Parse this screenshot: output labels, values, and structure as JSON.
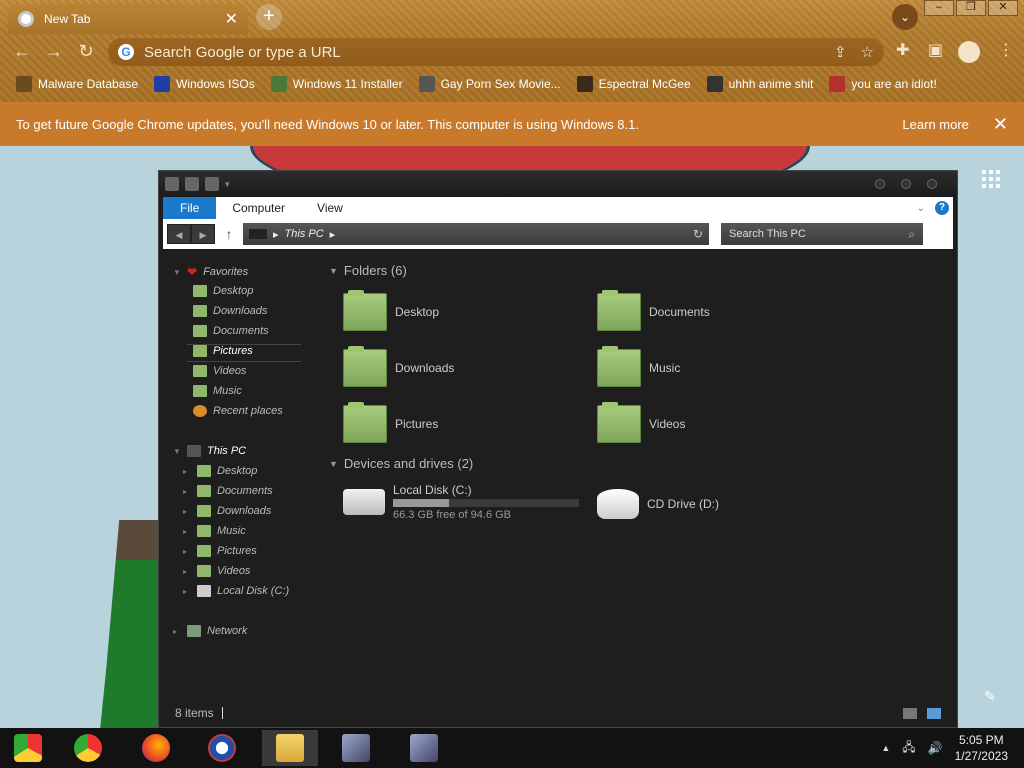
{
  "browser": {
    "tab": {
      "title": "New Tab"
    },
    "omnibox": {
      "placeholder": "Search Google or type a URL"
    },
    "bookmarks": [
      {
        "label": "Malware Database",
        "icon": "globe-icon",
        "color": "#6b4a1f"
      },
      {
        "label": "Windows ISOs",
        "icon": "x-logo-icon",
        "color": "#1f3ea8"
      },
      {
        "label": "Windows 11 Installer",
        "icon": "image-icon",
        "color": "#4a7a3a"
      },
      {
        "label": "Gay Porn Sex Movie...",
        "icon": "globe-icon",
        "color": "#555555"
      },
      {
        "label": "Espectral McGee",
        "icon": "character-icon",
        "color": "#3a2a1a"
      },
      {
        "label": "uhhh anime shit",
        "icon": "anime-icon",
        "color": "#333333"
      },
      {
        "label": "you are an idiot!",
        "icon": "flag-icon",
        "color": "#b23030"
      }
    ],
    "infobar": {
      "message": "To get future Google Chrome updates, you'll need Windows 10 or later. This computer is using Windows 8.1.",
      "action": "Learn more"
    }
  },
  "explorer": {
    "ribbon": {
      "file": "File",
      "tabs": [
        "Computer",
        "View"
      ]
    },
    "address": {
      "location": "This PC"
    },
    "search": {
      "placeholder": "Search This PC"
    },
    "nav": {
      "favorites": "Favorites",
      "fav_items": [
        "Desktop",
        "Downloads",
        "Documents",
        "Pictures",
        "Videos",
        "Music",
        "Recent places"
      ],
      "this_pc": "This PC",
      "pc_items": [
        "Desktop",
        "Documents",
        "Downloads",
        "Music",
        "Pictures",
        "Videos",
        "Local Disk (C:)"
      ],
      "network": "Network"
    },
    "folders_header": "Folders (6)",
    "folders": [
      "Desktop",
      "Documents",
      "Downloads",
      "Music",
      "Pictures",
      "Videos"
    ],
    "devices_header": "Devices and drives (2)",
    "drives": [
      {
        "name": "Local Disk (C:)",
        "free": "66.3 GB free of 94.6 GB",
        "used_fraction": 0.3
      },
      {
        "name": "CD Drive (D:)"
      }
    ],
    "status": "8 items"
  },
  "taskbar": {
    "apps": [
      "chrome-os-icon",
      "chrome-icon",
      "firefox-icon",
      "obama-logo-icon",
      "file-explorer-icon",
      "installer-icon",
      "installer-icon"
    ],
    "time": "5:05 PM",
    "date": "1/27/2023"
  }
}
